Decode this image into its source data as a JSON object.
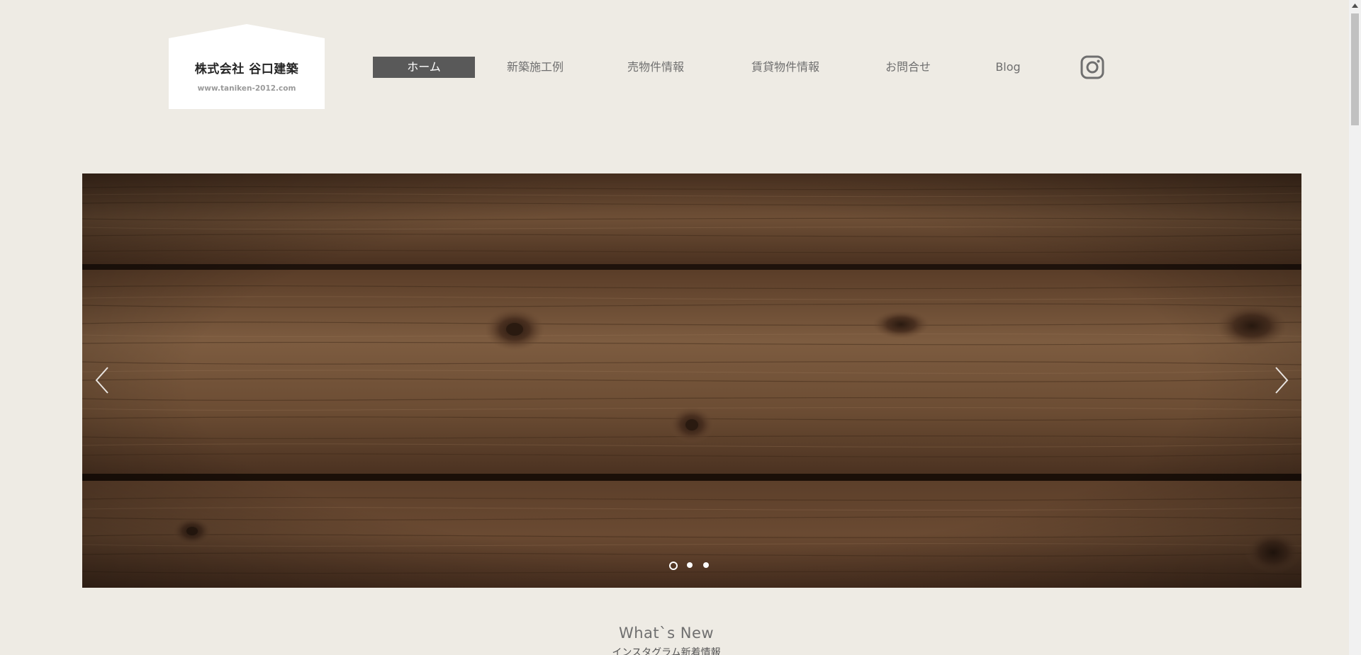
{
  "logo": {
    "name": "株式会社 谷口建築",
    "url": "www.taniken-2012.com"
  },
  "nav": {
    "items": [
      {
        "label": "ホーム",
        "active": true
      },
      {
        "label": "新築施工例",
        "active": false
      },
      {
        "label": "売物件情報",
        "active": false
      },
      {
        "label": "賃貸物件情報",
        "active": false
      },
      {
        "label": "お問合せ",
        "active": false
      },
      {
        "label": "Blog",
        "active": false
      }
    ],
    "social_icon": "instagram-icon"
  },
  "slider": {
    "slide_count": 3,
    "current_slide": 1,
    "prev_icon": "chevron-left-icon",
    "next_icon": "chevron-right-icon"
  },
  "whats_new": {
    "title": "What`s New",
    "subtitle": "インスタグラム新着情報"
  },
  "colors": {
    "background": "#eeebe4",
    "nav_active_bg": "#595959",
    "nav_text": "#6f6f6f",
    "wood_dark": "#3b2618",
    "wood_mid": "#6a4b33"
  }
}
